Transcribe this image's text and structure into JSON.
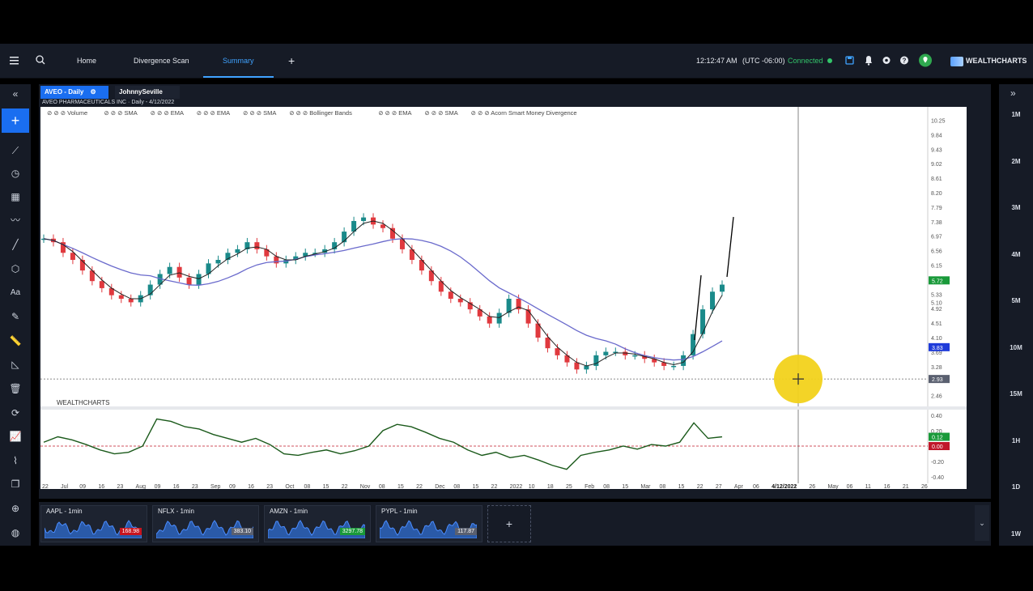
{
  "header": {
    "menu_icon": "hamburger-icon",
    "search_icon": "search-icon",
    "tabs": [
      "Home",
      "Divergence Scan",
      "Summary"
    ],
    "active_tab": "Summary",
    "add_tab_icon": "plus-icon",
    "time": "12:12:47 AM",
    "timezone": "(UTC -06:00)",
    "status": "Connected",
    "status_color": "#33c46a",
    "brand": "WEALTHCHARTS",
    "icons": [
      "save-icon",
      "bell-icon",
      "gear-icon",
      "help-icon",
      "location-icon"
    ]
  },
  "chart_tabs": [
    {
      "label": "AVEO - Daily",
      "active": true
    },
    {
      "label": "JohnnySeville",
      "active": false
    }
  ],
  "chart_title": "AVEO PHARMACEUTICALS INC · Daily - 4/12/2022",
  "indicators": [
    "Volume",
    "SMA",
    "EMA",
    "EMA",
    "SMA",
    "Bollinger Bands",
    "EMA",
    "SMA",
    "Acorn Smart Money Divergence"
  ],
  "price_axis": [
    "10.25",
    "9.84",
    "9.43",
    "9.02",
    "8.61",
    "8.20",
    "7.79",
    "7.38",
    "6.97",
    "6.56",
    "6.15",
    "5.72",
    "5.33",
    "5.10",
    "4.92",
    "4.51",
    "4.10",
    "3.83",
    "3.69",
    "3.28",
    "2.93",
    "2.46"
  ],
  "price_badges": [
    {
      "value": "5.72",
      "color": "#1a9a3a"
    },
    {
      "value": "3.83",
      "color": "#1e3bd9"
    },
    {
      "value": "2.93",
      "color": "#5a6070"
    }
  ],
  "osc_axis": [
    "0.40",
    "0.20",
    "0.12",
    "0.00",
    "-0.20",
    "-0.40"
  ],
  "osc_badges": [
    {
      "value": "0.12",
      "color": "#1a9a3a"
    },
    {
      "value": "0.00",
      "color": "#c0182a"
    }
  ],
  "date_axis": [
    "22",
    "Jul",
    "09",
    "16",
    "23",
    "Aug",
    "09",
    "16",
    "23",
    "Sep",
    "09",
    "16",
    "23",
    "Oct",
    "08",
    "15",
    "22",
    "Nov",
    "08",
    "15",
    "22",
    "Dec",
    "08",
    "15",
    "22",
    "2022",
    "10",
    "18",
    "25",
    "Feb",
    "08",
    "15",
    "Mar",
    "08",
    "15",
    "22",
    "27",
    "Apr",
    "06",
    "4/12/2022",
    "21",
    "26",
    "May",
    "06",
    "11",
    "16",
    "21",
    "26"
  ],
  "crosshair_date": "4/12/2022",
  "watermark": "WEALTHCHARTS",
  "timeframes": [
    "1M",
    "2M",
    "3M",
    "4M",
    "5M",
    "10M",
    "15M",
    "1H",
    "1D",
    "1W"
  ],
  "tickers": [
    {
      "symbol": "AAPL - 1min",
      "price": "168.98",
      "color": "#c8141e"
    },
    {
      "symbol": "NFLX - 1min",
      "price": "383.10",
      "color": "#5a6070"
    },
    {
      "symbol": "AMZN - 1min",
      "price": "3297.78",
      "color": "#1a9a3a"
    },
    {
      "symbol": "PYPL - 1min",
      "price": "117.87",
      "color": "#5a6070"
    }
  ],
  "colors": {
    "up": "#1a8a8a",
    "down": "#e0393e",
    "sma_fast": "#222222",
    "sma_slow": "#6a6acc",
    "osc": "#1b5a1b"
  },
  "chart_data": {
    "type": "candlestick",
    "price_series": [
      6.9,
      6.8,
      6.5,
      6.3,
      6.0,
      5.7,
      5.5,
      5.3,
      5.2,
      5.1,
      5.3,
      5.6,
      5.9,
      6.1,
      5.8,
      5.6,
      5.9,
      6.2,
      6.3,
      6.5,
      6.6,
      6.8,
      6.6,
      6.4,
      6.2,
      6.3,
      6.4,
      6.5,
      6.5,
      6.6,
      6.8,
      7.1,
      7.4,
      7.5,
      7.3,
      7.2,
      6.9,
      6.6,
      6.3,
      6.0,
      5.7,
      5.4,
      5.2,
      5.1,
      4.9,
      4.7,
      4.5,
      4.8,
      5.2,
      4.9,
      4.5,
      4.1,
      3.8,
      3.6,
      3.4,
      3.2,
      3.3,
      3.6,
      3.7,
      3.7,
      3.6,
      3.6,
      3.5,
      3.4,
      3.3,
      3.3,
      3.6,
      4.2,
      4.9,
      5.4,
      5.6
    ],
    "osc_series": [
      0.05,
      0.12,
      0.08,
      0.02,
      -0.05,
      -0.1,
      -0.08,
      0.0,
      0.35,
      0.32,
      0.25,
      0.22,
      0.15,
      0.1,
      0.05,
      0.1,
      0.02,
      -0.1,
      -0.12,
      -0.08,
      -0.05,
      -0.1,
      -0.06,
      0.0,
      0.2,
      0.28,
      0.25,
      0.18,
      0.1,
      0.05,
      -0.05,
      -0.12,
      -0.08,
      -0.15,
      -0.12,
      -0.18,
      -0.25,
      -0.3,
      -0.12,
      -0.08,
      -0.05,
      0.0,
      -0.04,
      0.02,
      0.0,
      0.05,
      0.3,
      0.1,
      0.12
    ],
    "ylim": [
      2.2,
      10.4
    ],
    "osc_ylim": [
      -0.45,
      0.45
    ]
  }
}
